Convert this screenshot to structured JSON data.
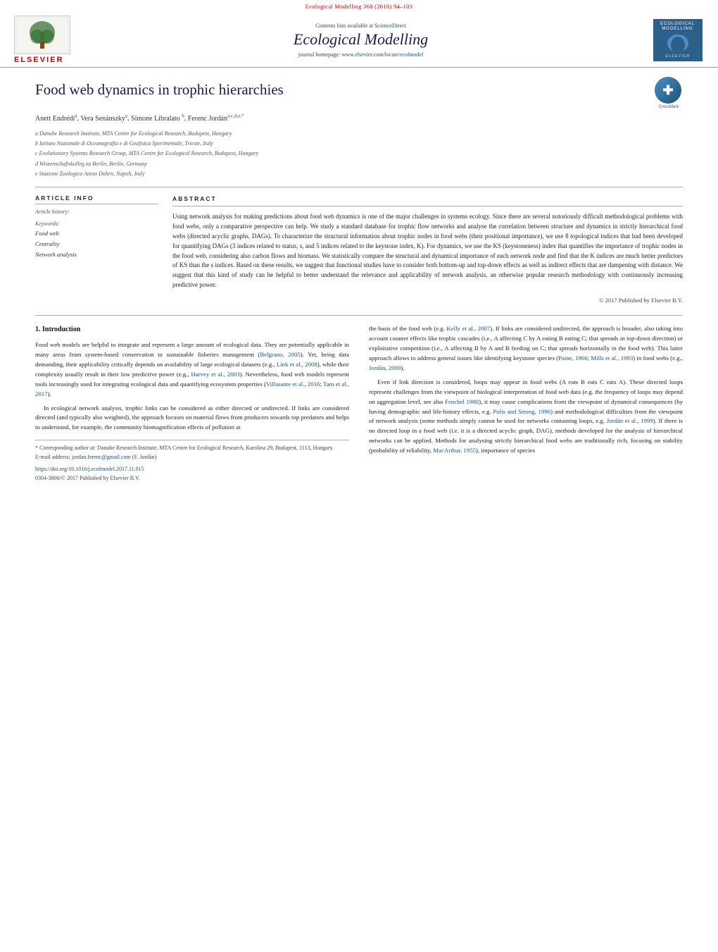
{
  "journal": {
    "top_bar": "Ecological Modelling 368 (2018) 94–103",
    "contents_label": "Contents lists available at",
    "contents_link": "ScienceDirect",
    "title": "Ecological Modelling",
    "homepage_label": "journal homepage:",
    "homepage_link": "www.elsevier.com/locate/ecolmodel",
    "elsevier_brand": "ELSEVIER",
    "logo_top_text": "ECOLOGICAL\nMODELLING"
  },
  "article": {
    "title": "Food web dynamics in trophic hierarchies",
    "authors": "Anett Endrédiᵃ, Vera Senánszkyᵃ, Simone Libralato ᵇ, Ferenc Jordánᵃʳᵈᵉ*",
    "affiliations": [
      "a  Danube Research Institute, MTA Centre for Ecological Research, Budapest, Hungary",
      "b  Istituto Nazionale di Oceanografia e di Geofisica Sperimentale, Trieste, Italy",
      "c  Evolutionary Systems Research Group, MTA Centre for Ecological Research, Budapest, Hungary",
      "d  Wissenschaftskolleg zu Berlin, Berlin, Germany",
      "e  Stazione Zoologica Anton Dohrn, Napoli, Italy"
    ],
    "article_info_header": "ARTICLE   INFO",
    "article_history_label": "Article history:",
    "keywords_label": "Keywords:",
    "keywords": [
      "Food web",
      "Centrality",
      "Network analysis"
    ],
    "abstract_header": "ABSTRACT",
    "abstract": "Using network analysis for making predictions about food web dynamics is one of the major challenges in systems ecology. Since there are several notoriously difficult methodological problems with food webs, only a comparative perspective can help. We study a standard database for trophic flow networks and analyse the correlation between structure and dynamics in strictly hierarchical food webs (directed acyclic graphs, DAGs). To characterize the structural information about trophic nodes in food webs (their positional importance), we use 8 topological indices that had been developed for quantifying DAGs (3 indices related to status, s, and 5 indices related to the keystone index, K). For dynamics, we use the KS (keystoneness) index that quantifies the importance of trophic nodes in the food web, considering also carbon flows and biomass. We statistically compare the structural and dynamical importance of each network node and find that the K indices are much better predictors of KS than the s indices. Based on these results, we suggest that functional studies have to consider both bottom-up and top-down effects as well as indirect effects that are dampening with distance. We suggest that this kind of study can be helpful to better understand the relevance and applicability of network analysis, an otherwise popular research methodology with continuously increasing predictive power.",
    "copyright": "© 2017 Published by Elsevier B.V."
  },
  "intro": {
    "section_number": "1.",
    "section_title": "Introduction",
    "col1_paragraphs": [
      "Food web models are helpful to integrate and represent a large amount of ecological data. They are potentially applicable in many areas from system-based conservation to sustainable fisheries management (Belgrano, 2005). Yet, being data demanding, their applicability critically depends on availability of large ecological datasets (e.g., Link et al., 2008), while their complexity usually result in their low predictive power (e.g., Harvey et al., 2003). Nevertheless, food web models represent tools increasingly used for integrating ecological data and quantifying ecosystem properties (Villasante et al., 2016; Tam et al., 2017).",
      "In ecological network analysis, trophic links can be considered as either directed or undirected. If links are considered directed (and typically also weighted), the approach focuses on material flows from producers towards top predators and helps to understand, for example, the community biomagnification effects of pollution at"
    ],
    "col2_paragraphs": [
      "the basis of the food web (e.g. Kelly et al., 2007). If links are considered undirected, the approach is broader, also taking into account counter effects like trophic cascades (i.e., A affecting C by A eating B eating C; that spreads in top-down direction) or exploitative competition (i.e., A affecting B by A and B feeding on C; that spreads horizontally in the food web). This latter approach allows to address general issues like identifying keystone species (Paine, 1966; Mills et al., 1993) in food webs (e.g., Jordán, 2009).",
      "Even if link direction is considered, loops may appear in food webs (A eats B eats C eats A). These directed loops represent challenges from the viewpoint of biological interpretation of food web data (e.g. the frequency of loops may depend on aggregation level, see also Fenchel 1988), it may cause complications from the viewpoint of dynamical consequences (by having demographic and life-history effects, e.g. Polis and Strong, 1996) and methodological difficulties from the viewpoint of network analysis (some methods simply cannot be used for networks containing loops, e.g. Jordán et al., 1999). If there is no directed loop in a food web (i.e. it is a directed acyclic graph, DAG), methods developed for the analysis of hierarchical networks can be applied. Methods for analysing strictly hierarchical food webs are traditionally rich, focusing on stability (probability of reliability, MacArthur, 1955), importance of species"
    ]
  },
  "footnote": {
    "corresponding": "* Corresponding author at: Danube Research Institute, MTA Centre for Ecological Research, Karolina 29, Budapest, 1113, Hungary.",
    "email_label": "E-mail address:",
    "email": "jordan.ferenc@gmail.com",
    "email_name": "F. Jordán",
    "doi": "https://doi.org/10.1016/j.ecolmodel.2017.11.015",
    "issn": "0304-3800/© 2017 Published by Elsevier B.V."
  }
}
